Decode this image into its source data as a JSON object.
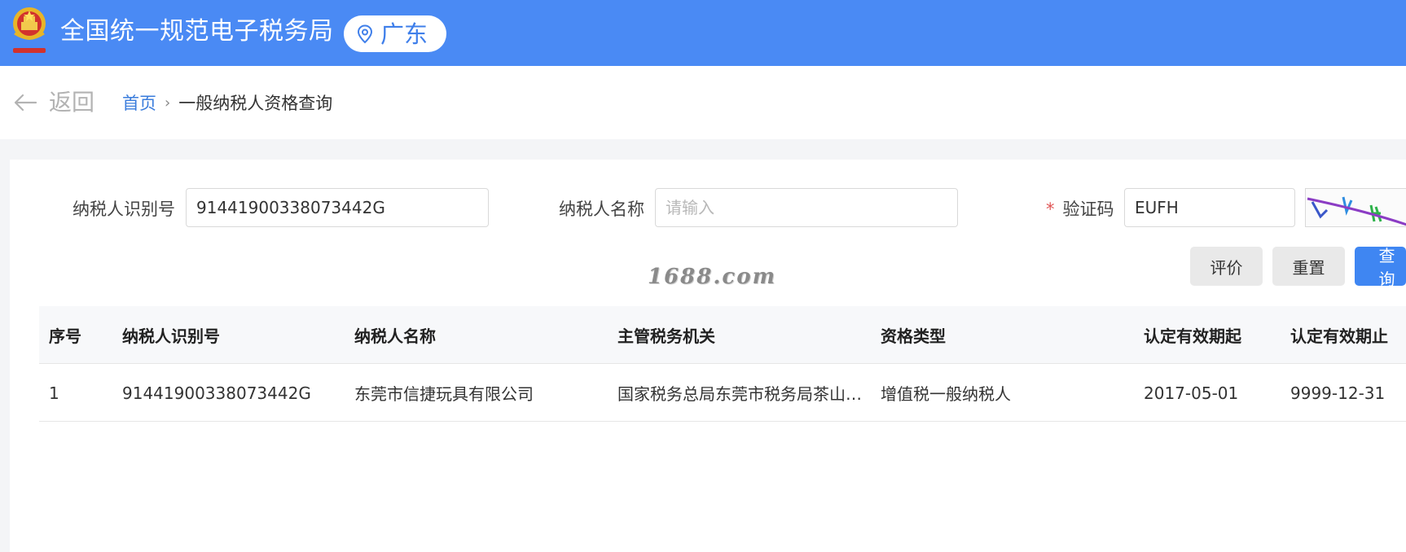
{
  "header": {
    "site_title": "全国统一规范电子税务局",
    "region": "广东",
    "brand_color": "#4a8af4"
  },
  "breadcrumb": {
    "back_label": "返回",
    "home": "首页",
    "separator": "›",
    "current": "一般纳税人资格查询"
  },
  "form": {
    "taxpayer_id": {
      "label": "纳税人识别号",
      "value": "91441900338073442G"
    },
    "taxpayer_name": {
      "label": "纳税人名称",
      "value": "",
      "placeholder": "请输入"
    },
    "captcha": {
      "required_mark": "*",
      "label": "验证码",
      "value": "EUFH"
    },
    "buttons": {
      "evaluate": "评价",
      "reset": "重置",
      "query": "查询"
    }
  },
  "watermark": "1688.com",
  "table": {
    "columns": [
      "序号",
      "纳税人识别号",
      "纳税人名称",
      "主管税务机关",
      "资格类型",
      "认定有效期起",
      "认定有效期止"
    ],
    "rows": [
      [
        "1",
        "91441900338073442G",
        "东莞市信捷玩具有限公司",
        "国家税务总局东莞市税务局茶山税务分局",
        "增值税一般纳税人",
        "2017-05-01",
        "9999-12-31"
      ]
    ]
  }
}
